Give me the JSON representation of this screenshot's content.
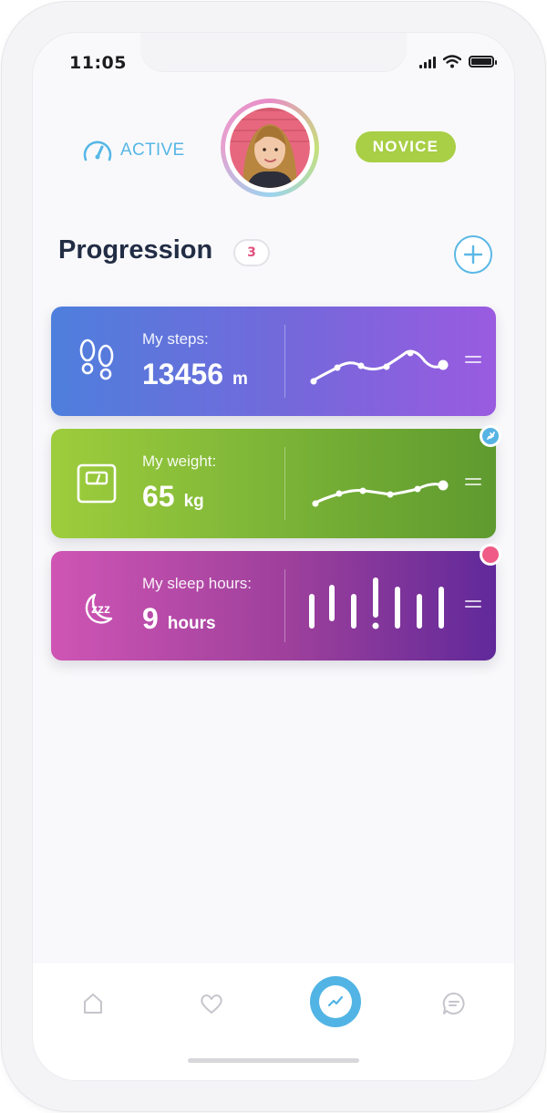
{
  "status_bar": {
    "time": "11:05"
  },
  "profile": {
    "status_label": "ACTIVE",
    "level_badge": "NOVICE",
    "avatar_icon": "user-avatar"
  },
  "section": {
    "title": "Progression",
    "count": "3"
  },
  "cards": [
    {
      "label": "My steps:",
      "value": "13456",
      "unit": "m",
      "icon": "footprints-icon",
      "graph": "line"
    },
    {
      "label": "My weight:",
      "value": "65",
      "unit": "kg",
      "icon": "scale-icon",
      "graph": "line"
    },
    {
      "label": "My sleep hours:",
      "value": "9",
      "unit": "hours",
      "icon": "sleep-icon",
      "graph": "bars"
    }
  ],
  "tabs": [
    "home-icon",
    "heart-icon",
    "chart-icon",
    "chat-icon"
  ],
  "colors": {
    "accent": "#56b7e6",
    "novice": "#a8cf45",
    "badge_count": "#e2527f",
    "alert": "#ef5b86"
  }
}
